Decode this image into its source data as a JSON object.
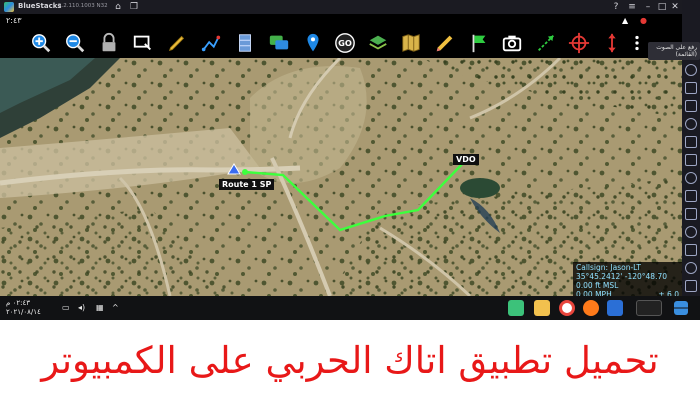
{
  "titlebar": {
    "app_name": "BlueStacks",
    "version": "5.2.110.1003 N32",
    "icons": [
      "home-icon",
      "multi-instance-icon"
    ],
    "controls": [
      "help-icon",
      "menu-icon",
      "minimize-icon",
      "maximize-icon",
      "close-icon"
    ]
  },
  "status": {
    "time": "٢:٤٣",
    "icons": [
      "notification-icon",
      "app-icon"
    ]
  },
  "toolbar": {
    "tools": [
      {
        "name": "zoom-in-icon",
        "color": "#1e88e5"
      },
      {
        "name": "zoom-out-icon",
        "color": "#1e88e5"
      },
      {
        "name": "lock-icon",
        "color": "#b0b0b0"
      },
      {
        "name": "rectangle-select-icon",
        "color": "#ffffff"
      },
      {
        "name": "pencil-icon",
        "color": "#f0c040"
      },
      {
        "name": "route-icon",
        "color": "#3aa0ff"
      },
      {
        "name": "layers-panel-icon",
        "color": "#6a9ad8"
      },
      {
        "name": "chat-icon",
        "color": "#43b04a"
      },
      {
        "name": "map-pin-icon",
        "color": "#1e88e5"
      },
      {
        "name": "go-to-icon",
        "color": "#ffffff"
      },
      {
        "name": "map-layers-icon",
        "color": "#4caf50"
      },
      {
        "name": "imagery-icon",
        "color": "#d9b44a"
      },
      {
        "name": "draw-icon",
        "color": "#f0c040"
      },
      {
        "name": "flag-icon",
        "color": "#2ecc40"
      },
      {
        "name": "camera-icon",
        "color": "#ffffff"
      },
      {
        "name": "bearing-icon",
        "color": "#2ecc40"
      },
      {
        "name": "crosshair-icon",
        "color": "#e53935"
      },
      {
        "name": "elevation-icon",
        "color": "#e53935"
      },
      {
        "name": "overflow-menu-icon",
        "color": "#ffffff"
      }
    ]
  },
  "sidebar": {
    "tooltip": "رفع على الصوت (القائمة)",
    "icons": [
      "fullscreen-icon",
      "keyboard-icon",
      "volume-up-icon",
      "volume-down-icon",
      "screen-icon",
      "location-icon",
      "rotate-icon",
      "shake-icon",
      "camera-icon",
      "folder-icon",
      "apk-icon",
      "macro-icon",
      "eco-mode-icon",
      "settings-icon",
      "back-icon",
      "home-icon"
    ]
  },
  "map": {
    "labels": {
      "route": "Route 1 SP",
      "vdo": "VDO"
    },
    "route_color": "#3dff3d",
    "info": {
      "callsign": "Callsign: Jason-LT",
      "coords": "35°45.2412'   -120°48.70",
      "altitude": "0.00 ft MSL",
      "speed": "0.00 MPH",
      "heading": "± 6.0"
    }
  },
  "taskbar": {
    "clock_time": "٠٢:٤٣ م",
    "clock_date": "٢٠٢١/٠٨/١٤",
    "apps": [
      {
        "name": "bluestacks-taskbar-icon",
        "color": "#3cc27a"
      },
      {
        "name": "file-explorer-icon",
        "color": "#f2c14e"
      },
      {
        "name": "chrome-icon",
        "color": "#e8453c"
      },
      {
        "name": "firefox-icon",
        "color": "#ff7a1a"
      },
      {
        "name": "app-taskbar-icon",
        "color": "#2b6fd6"
      },
      {
        "name": "windows-start-icon",
        "color": "#3a8fe0"
      }
    ]
  },
  "caption": "تحميل تطبيق اتاك الحربي على الكمبيوتر"
}
